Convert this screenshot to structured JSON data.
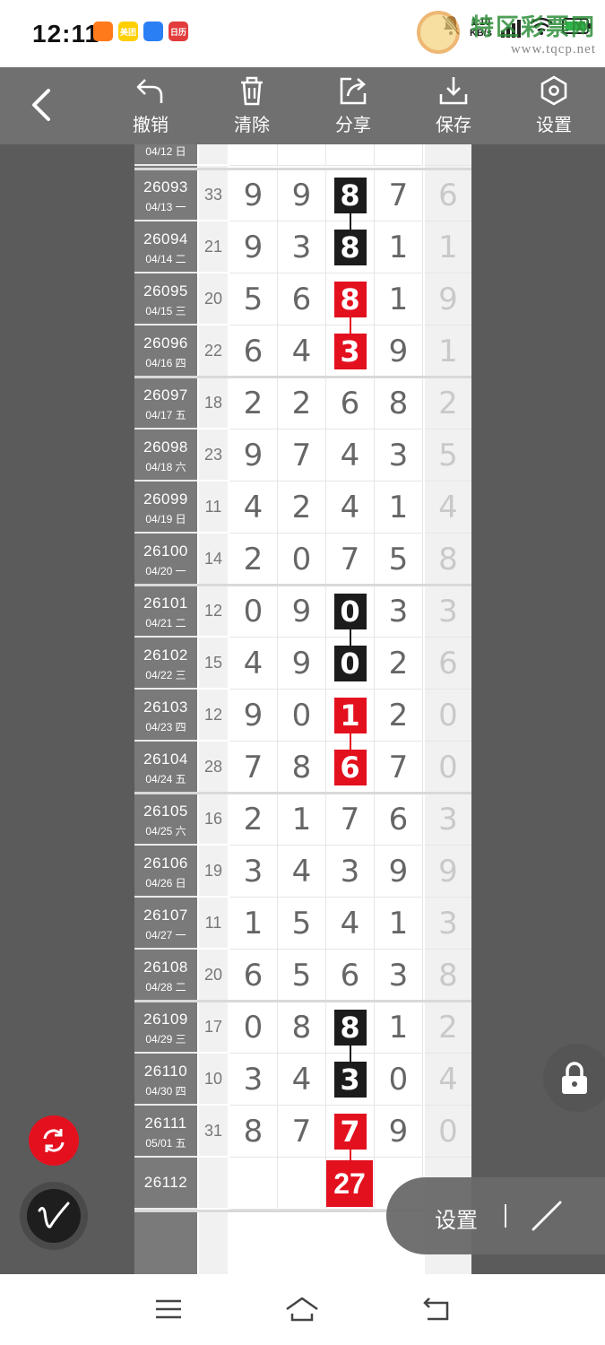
{
  "status_bar": {
    "time": "12:11",
    "app_icons": [
      {
        "name": "video-app-icon",
        "color": "#ff7a1a",
        "text": ""
      },
      {
        "name": "meituan-app-icon",
        "color": "#ffcf00",
        "text": "美团"
      },
      {
        "name": "blue-app-icon",
        "color": "#2b7ff5",
        "text": ""
      },
      {
        "name": "calendar-app-icon",
        "color": "#e23c3c",
        "text": "日历"
      }
    ],
    "network_speed_value": "1.10",
    "network_speed_unit": "KB/s"
  },
  "watermark": {
    "title": "特区彩票网",
    "url": "www.tqcp.net"
  },
  "toolbar": {
    "undo_label": "撤销",
    "clear_label": "清除",
    "share_label": "分享",
    "save_label": "保存",
    "settings_label": "设置"
  },
  "partial_top_row": {
    "date": "04/12 日"
  },
  "rows": [
    {
      "issue": "26093",
      "date": "04/13 一",
      "sum": "33",
      "digits": [
        "9",
        "9",
        "8",
        "7"
      ],
      "last": "6",
      "mark": "black"
    },
    {
      "issue": "26094",
      "date": "04/14 二",
      "sum": "21",
      "digits": [
        "9",
        "3",
        "8",
        "1"
      ],
      "last": "1",
      "mark": "black"
    },
    {
      "issue": "26095",
      "date": "04/15 三",
      "sum": "20",
      "digits": [
        "5",
        "6",
        "8",
        "1"
      ],
      "last": "9",
      "mark": "red"
    },
    {
      "issue": "26096",
      "date": "04/16 四",
      "sum": "22",
      "digits": [
        "6",
        "4",
        "3",
        "9"
      ],
      "last": "1",
      "mark": "red"
    },
    {
      "issue": "26097",
      "date": "04/17 五",
      "sum": "18",
      "digits": [
        "2",
        "2",
        "6",
        "8"
      ],
      "last": "2",
      "mark": ""
    },
    {
      "issue": "26098",
      "date": "04/18 六",
      "sum": "23",
      "digits": [
        "9",
        "7",
        "4",
        "3"
      ],
      "last": "5",
      "mark": ""
    },
    {
      "issue": "26099",
      "date": "04/19 日",
      "sum": "11",
      "digits": [
        "4",
        "2",
        "4",
        "1"
      ],
      "last": "4",
      "mark": ""
    },
    {
      "issue": "26100",
      "date": "04/20 一",
      "sum": "14",
      "digits": [
        "2",
        "0",
        "7",
        "5"
      ],
      "last": "8",
      "mark": ""
    },
    {
      "issue": "26101",
      "date": "04/21 二",
      "sum": "12",
      "digits": [
        "0",
        "9",
        "0",
        "3"
      ],
      "last": "3",
      "mark": "black"
    },
    {
      "issue": "26102",
      "date": "04/22 三",
      "sum": "15",
      "digits": [
        "4",
        "9",
        "0",
        "2"
      ],
      "last": "6",
      "mark": "black"
    },
    {
      "issue": "26103",
      "date": "04/23 四",
      "sum": "12",
      "digits": [
        "9",
        "0",
        "1",
        "2"
      ],
      "last": "0",
      "mark": "red"
    },
    {
      "issue": "26104",
      "date": "04/24 五",
      "sum": "28",
      "digits": [
        "7",
        "8",
        "6",
        "7"
      ],
      "last": "0",
      "mark": "red"
    },
    {
      "issue": "26105",
      "date": "04/25 六",
      "sum": "16",
      "digits": [
        "2",
        "1",
        "7",
        "6"
      ],
      "last": "3",
      "mark": ""
    },
    {
      "issue": "26106",
      "date": "04/26 日",
      "sum": "19",
      "digits": [
        "3",
        "4",
        "3",
        "9"
      ],
      "last": "9",
      "mark": ""
    },
    {
      "issue": "26107",
      "date": "04/27 一",
      "sum": "11",
      "digits": [
        "1",
        "5",
        "4",
        "1"
      ],
      "last": "3",
      "mark": ""
    },
    {
      "issue": "26108",
      "date": "04/28 二",
      "sum": "20",
      "digits": [
        "6",
        "5",
        "6",
        "3"
      ],
      "last": "8",
      "mark": ""
    },
    {
      "issue": "26109",
      "date": "04/29 三",
      "sum": "17",
      "digits": [
        "0",
        "8",
        "8",
        "1"
      ],
      "last": "2",
      "mark": "black"
    },
    {
      "issue": "26110",
      "date": "04/30 四",
      "sum": "10",
      "digits": [
        "3",
        "4",
        "3",
        "0"
      ],
      "last": "4",
      "mark": "black"
    },
    {
      "issue": "26111",
      "date": "05/01 五",
      "sum": "31",
      "digits": [
        "8",
        "7",
        "7",
        "9"
      ],
      "last": "0",
      "mark": "red"
    }
  ],
  "prediction_row": {
    "issue": "26112",
    "value": "27"
  },
  "floating": {
    "settings_label": "设置"
  },
  "colors": {
    "mark_red": "#e3101e",
    "mark_black": "#1c1c1c",
    "toolbar_bg": "#707070",
    "issue_col_bg": "#7a7a7a"
  }
}
